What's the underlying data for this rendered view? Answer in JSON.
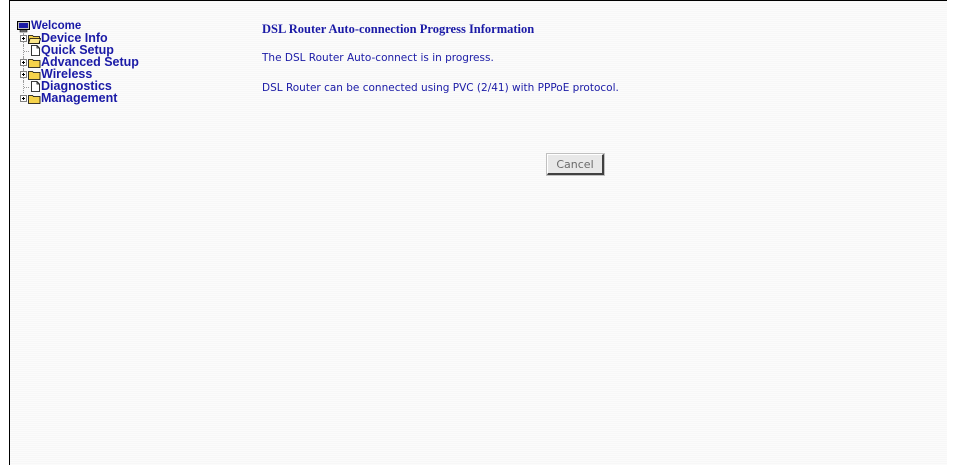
{
  "sidebar": {
    "items": [
      {
        "label": "Welcome",
        "icon": "monitor-icon"
      },
      {
        "label": "Device Info",
        "icon": "folder-open-icon",
        "expandable": true
      },
      {
        "label": "Quick Setup",
        "icon": "document-icon",
        "expandable": false
      },
      {
        "label": "Advanced Setup",
        "icon": "folder-icon",
        "expandable": true
      },
      {
        "label": "Wireless",
        "icon": "folder-icon",
        "expandable": true
      },
      {
        "label": "Diagnostics",
        "icon": "document-icon",
        "expandable": false
      },
      {
        "label": "Management",
        "icon": "folder-icon",
        "expandable": true
      }
    ]
  },
  "main": {
    "title": "DSL Router Auto-connection Progress Information",
    "status_text": "The DSL Router Auto-connect is in progress.",
    "connection_text": "DSL Router can be connected using PVC (2/41) with PPPoE protocol.",
    "cancel_label": "Cancel"
  },
  "colors": {
    "link_blue": "#1a1aa6",
    "folder_yellow": "#f5d24a",
    "background": "#f9f9f9"
  }
}
